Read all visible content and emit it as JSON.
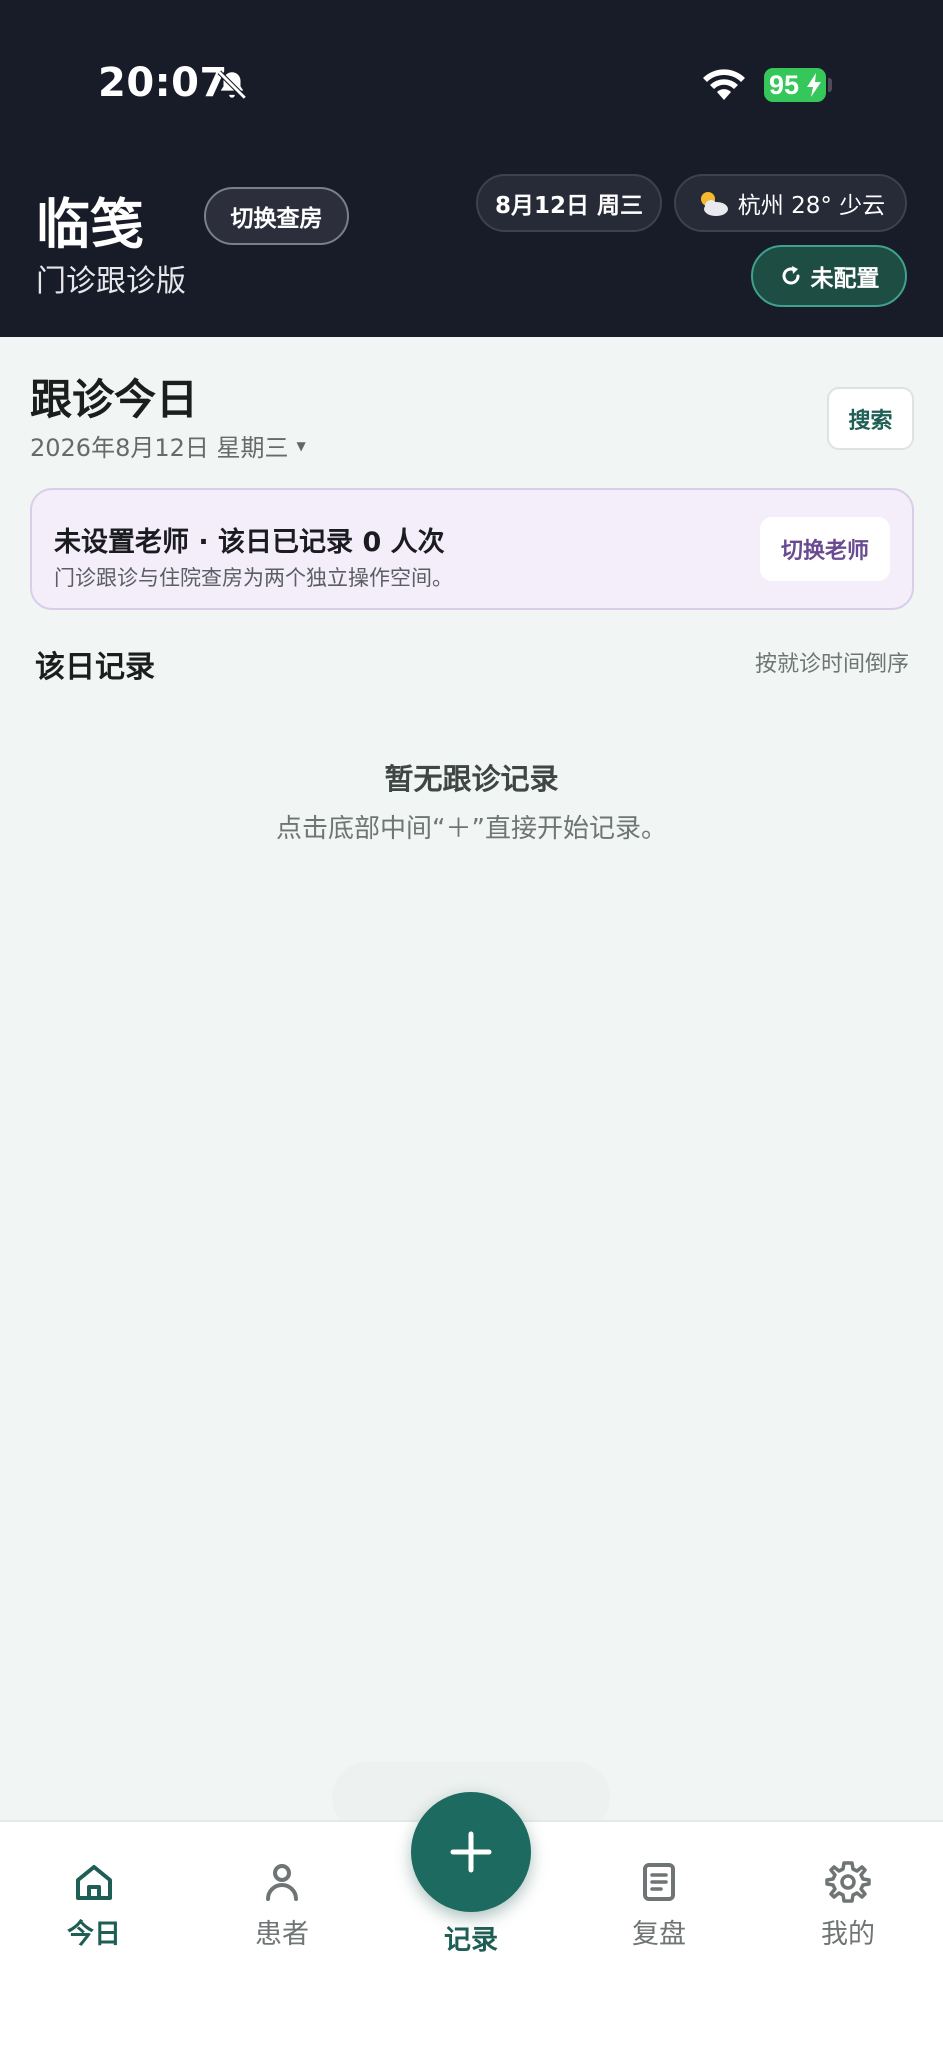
{
  "status_bar": {
    "time": "20:07",
    "battery": "95",
    "icons": [
      "bell-slash-icon",
      "wifi-icon",
      "battery-charging-icon"
    ]
  },
  "header": {
    "app_title": "临笺",
    "subtitle": "门诊跟诊版",
    "switch_ward_label": "切换查房",
    "date_label": "8月12日 周三",
    "weather_label": "杭州 28° 少云",
    "weather_icon": "partly-cloudy-icon",
    "config_label": "未配置"
  },
  "main": {
    "section_title": "跟诊今日",
    "date_line": "2026年8月12日 星期三",
    "search_label": "搜索",
    "teacher_card": {
      "status": "未设置老师 · 该日已记录 0 人次",
      "description": "门诊跟诊与住院查房为两个独立操作空间。",
      "switch_label": "切换老师"
    },
    "records_title": "该日记录",
    "sort_label": "按就诊时间倒序",
    "empty_title": "暂无跟诊记录",
    "empty_desc": "点击底部中间“＋”直接开始记录。"
  },
  "bottom_nav": {
    "items": [
      {
        "label": "今日",
        "icon": "home-icon",
        "active": true
      },
      {
        "label": "患者",
        "icon": "person-icon",
        "active": false
      },
      {
        "label": "记录",
        "icon": "plus-icon",
        "active": true
      },
      {
        "label": "复盘",
        "icon": "notebook-icon",
        "active": false
      },
      {
        "label": "我的",
        "icon": "gear-icon",
        "active": false
      }
    ]
  },
  "colors": {
    "header_bg": "#181b28",
    "accent": "#1d6a60",
    "page_bg": "#f1f5f4",
    "teacher_card_bg": "#f3eefa",
    "teacher_accent": "#6a4a91"
  }
}
